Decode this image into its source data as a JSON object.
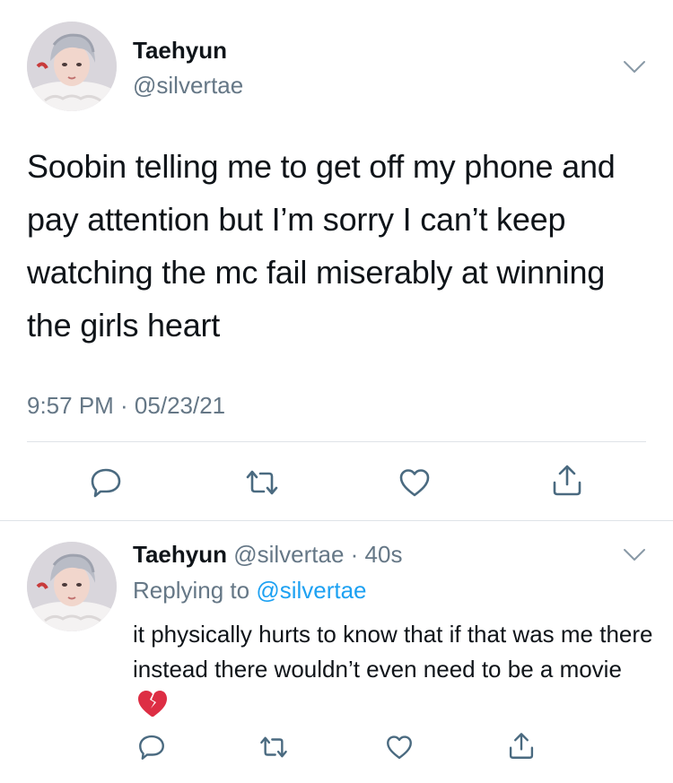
{
  "tweet": {
    "author_name": "Taehyun",
    "author_handle": "@silvertae",
    "text": "Soobin telling me to get off my phone and pay attention but I’m sorry I can’t keep watching the mc fail miserably at winning the girls heart",
    "timestamp": "9:57 PM · 05/23/21"
  },
  "reply": {
    "author_name": "Taehyun",
    "author_handle": "@silvertae",
    "age": "· 40s",
    "replying_prefix": "Replying to",
    "replying_to": "@silvertae",
    "text": "it physically hurts to know that if that was me there instead there wouldn’t even need to be a movie",
    "emoji": "broken-heart-emoji"
  },
  "icons": {
    "reply": "reply-icon",
    "retweet": "retweet-icon",
    "like": "heart-icon",
    "share": "share-icon",
    "menu": "chevron-down-icon"
  },
  "colors": {
    "text": "#0f1419",
    "secondary": "#657786",
    "link": "#1da1f2",
    "icon": "#4a6a80",
    "divider": "#dfe3e8"
  }
}
